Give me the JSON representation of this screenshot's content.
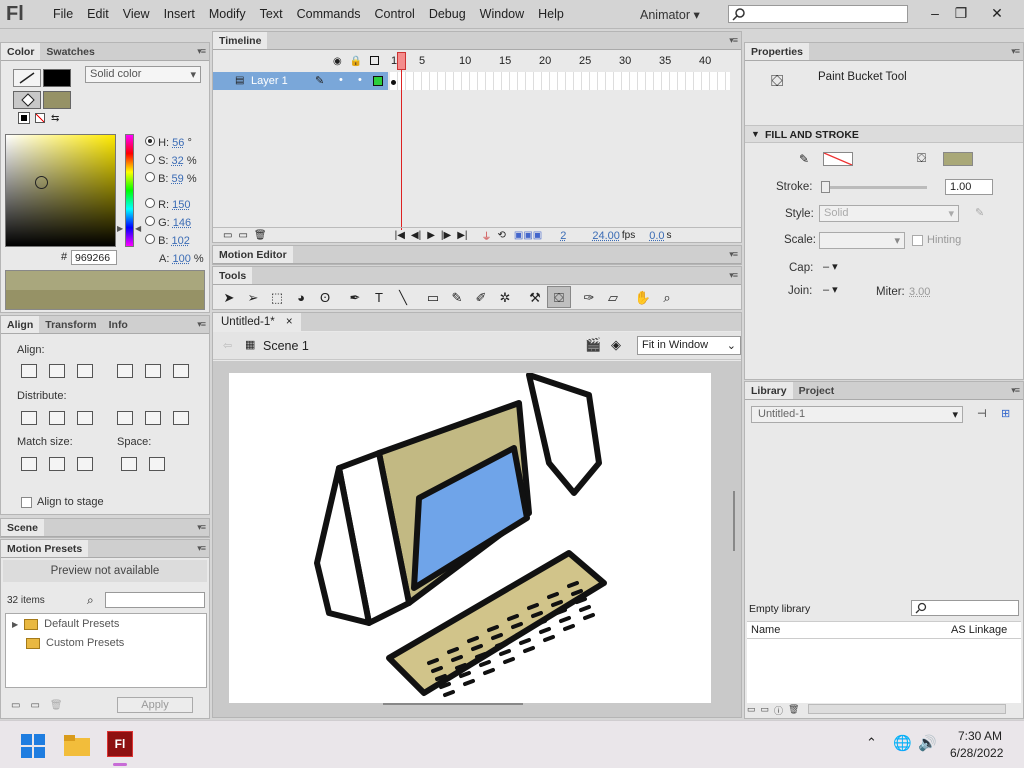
{
  "app": {
    "logo": "Fl",
    "workspace": "Animator",
    "workspace_arrow": "▾"
  },
  "menu": [
    "File",
    "Edit",
    "View",
    "Insert",
    "Modify",
    "Text",
    "Commands",
    "Control",
    "Debug",
    "Window",
    "Help"
  ],
  "color_panel": {
    "tabs": [
      "Color",
      "Swatches"
    ],
    "fill_type": "Solid color",
    "hsb": {
      "h_label": "H:",
      "h": "56",
      "h_unit": "°",
      "s_label": "S:",
      "s": "32",
      "s_unit": "%",
      "b_label": "B:",
      "b": "59",
      "b_unit": "%"
    },
    "rgb": {
      "r_label": "R:",
      "r": "150",
      "g_label": "G:",
      "g": "146",
      "b_label": "B:",
      "b": "102"
    },
    "alpha_label": "A:",
    "alpha": "100",
    "alpha_unit": "%",
    "hex_label": "#",
    "hex": "969266",
    "fill_color": "#969266"
  },
  "align_panel": {
    "tabs": [
      "Align",
      "Transform",
      "Info"
    ],
    "align_label": "Align:",
    "distribute_label": "Distribute:",
    "match_label": "Match size:",
    "space_label": "Space:",
    "align_to_stage": "Align to stage"
  },
  "scene_panel": {
    "title": "Scene"
  },
  "motion_presets": {
    "title": "Motion Presets",
    "preview": "Preview not available",
    "count": "32 items",
    "folders": [
      "Default Presets",
      "Custom Presets"
    ],
    "apply": "Apply"
  },
  "timeline": {
    "title": "Timeline",
    "frame_numbers": [
      "1",
      "5",
      "10",
      "15",
      "20",
      "25",
      "30",
      "35",
      "40"
    ],
    "layer": "Layer 1",
    "current_frame": "2",
    "fps": "24.00",
    "fps_unit": "fps",
    "time": "0.0",
    "time_unit": "s"
  },
  "motion_editor": {
    "title": "Motion Editor"
  },
  "tools": {
    "title": "Tools"
  },
  "document": {
    "tab": "Untitled-1*",
    "close": "×",
    "scene": "Scene 1",
    "zoom": "Fit in Window"
  },
  "properties": {
    "title": "Properties",
    "tool": "Paint Bucket Tool",
    "section": "FILL AND STROKE",
    "stroke_label": "Stroke:",
    "stroke": "1.00",
    "style_label": "Style:",
    "style": "Solid",
    "scale_label": "Scale:",
    "hinting": "Hinting",
    "cap_label": "Cap:",
    "join_label": "Join:",
    "miter_label": "Miter:",
    "miter": "3.00",
    "stroke_color": "#e0a0a0",
    "fill_color": "#a9a878"
  },
  "library": {
    "tabs": [
      "Library",
      "Project"
    ],
    "doc": "Untitled-1",
    "empty": "Empty library",
    "col_name": "Name",
    "col_linkage": "AS Linkage"
  },
  "taskbar": {
    "time": "7:30 AM",
    "date": "6/28/2022",
    "flash_label": "Fl"
  }
}
